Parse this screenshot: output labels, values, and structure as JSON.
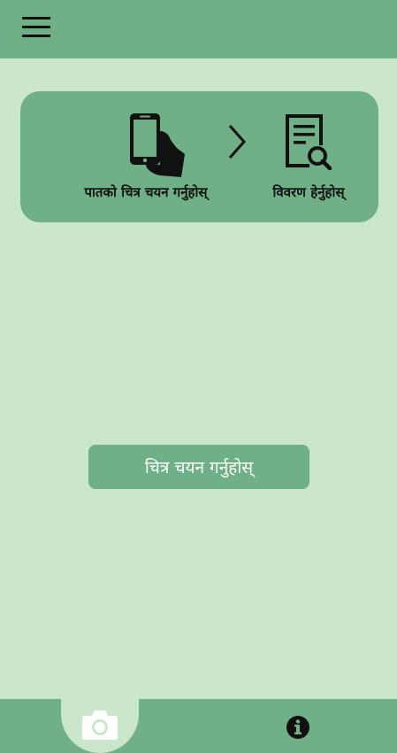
{
  "app_bar": {
    "menu_icon": "hamburger-menu-icon"
  },
  "steps": [
    {
      "icon": "phone-in-hand-icon",
      "label": "पातको चित्र चयन गर्नुहोस्"
    },
    {
      "icon": "chevron-right-icon"
    },
    {
      "icon": "document-search-icon",
      "label": "विवरण हेर्नुहोस्"
    }
  ],
  "main": {
    "select_image_button": "चित्र चयन गर्नुहोस्"
  },
  "bottom_nav": {
    "tabs": [
      {
        "icon": "camera-icon",
        "active": true
      },
      {
        "icon": "info-icon",
        "active": false
      }
    ]
  },
  "colors": {
    "background": "#cae6cb",
    "accent": "#6fb086"
  }
}
